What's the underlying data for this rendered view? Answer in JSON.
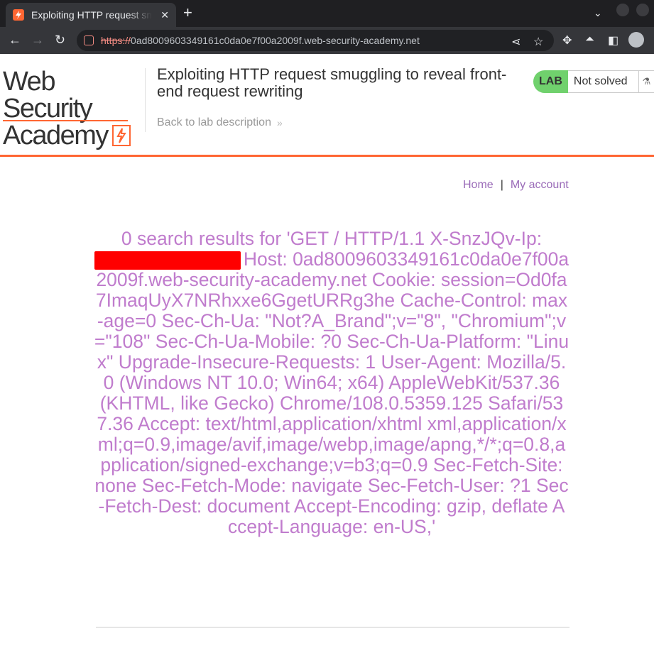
{
  "browser": {
    "tab_title": "Exploiting HTTP request smuggling",
    "url_scheme": "https://",
    "url_rest": "0ad8009603349161c0da0e7f00a2009f.web-security-academy.net"
  },
  "header": {
    "logo_line1": "Web Security",
    "logo_line2": "Academy",
    "lab_title": "Exploiting HTTP request smuggling to reveal front-end request rewriting",
    "back_link": "Back to lab description",
    "lab_badge": "LAB",
    "lab_state": "Not solved"
  },
  "nav": {
    "home": "Home",
    "separator": "|",
    "account": "My account"
  },
  "results": {
    "prefix": "0 search results for 'GET / HTTP/1.1 X-SnzJQv-Ip:",
    "rest": "Host: 0ad8009603349161c0da0e7f00a2009f.web-security-academy.net Cookie: session=Od0fa7ImaqUyX7NRhxxe6GgetURRg3he Cache-Control: max-age=0 Sec-Ch-Ua: \"Not?A_Brand\";v=\"8\", \"Chromium\";v=\"108\" Sec-Ch-Ua-Mobile: ?0 Sec-Ch-Ua-Platform: \"Linux\" Upgrade-Insecure-Requests: 1 User-Agent: Mozilla/5.0 (Windows NT 10.0; Win64; x64) AppleWebKit/537.36 (KHTML, like Gecko) Chrome/108.0.5359.125 Safari/537.36 Accept: text/html,application/xhtml xml,application/xml;q=0.9,image/avif,image/webp,image/apng,*/*;q=0.8,application/signed-exchange;v=b3;q=0.9 Sec-Fetch-Site: none Sec-Fetch-Mode: navigate Sec-Fetch-User: ?1 Sec-Fetch-Dest: document Accept-Encoding: gzip, deflate Accept-Language: en-US,'"
  },
  "colors": {
    "accent": "#ff6633",
    "link": "#9a6bb8",
    "result_text": "#c07ccd",
    "lab_badge": "#70d16d",
    "redaction": "#ff0000"
  }
}
